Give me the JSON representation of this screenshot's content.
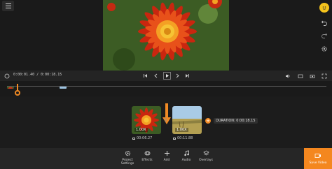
{
  "player": {
    "current_time": "0:00:01.40",
    "total_time": "0:00:18.15",
    "separator": " / "
  },
  "timeline": {
    "clips": [
      {
        "speed": "1.00X",
        "duration": "00:06.27"
      },
      {
        "speed": "1.00X",
        "duration": "00:11.88"
      }
    ],
    "total_duration": "DURATION: 0:00:18.15",
    "add_symbol": "+",
    "transition_symbol": "ǁ"
  },
  "toolbar": {
    "project_settings": "Project Settings",
    "effects": "Effects",
    "add": "Add",
    "audio": "Audio",
    "overlays": "Overlays",
    "save_video": "Save Video"
  },
  "icons": {
    "menu": "hamburger-menu-icon",
    "emoji": "emoji-icon",
    "undo": "undo-icon",
    "redo": "redo-icon",
    "settings": "gear-icon"
  },
  "colors": {
    "accent": "#f4871f",
    "playhead": "#f08a24",
    "background": "#1c1c1c",
    "toolbar": "#262626"
  }
}
